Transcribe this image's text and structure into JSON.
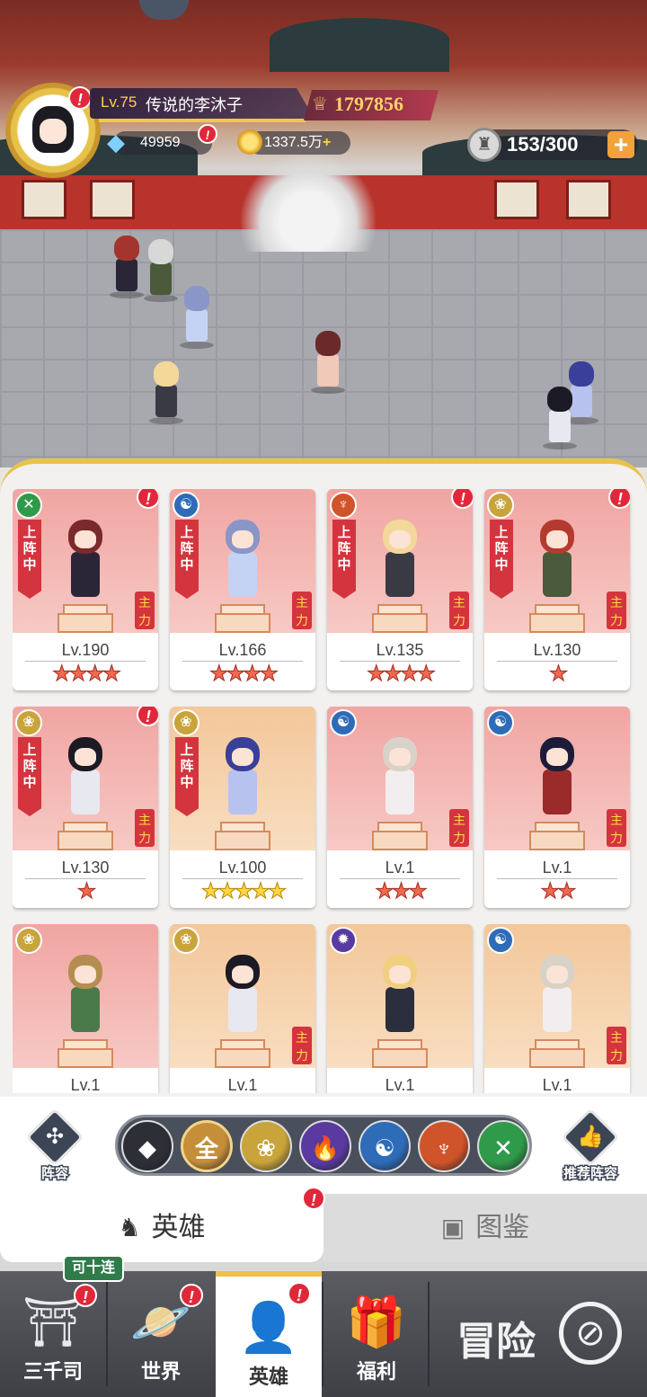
{
  "player": {
    "level": "Lv.75",
    "name": "传说的李沐子",
    "power": "1797856",
    "gems": "49959",
    "gold": "1337.5万",
    "capacity": "153/300"
  },
  "heroes": [
    {
      "level": "Lv.190",
      "stars": 4,
      "element": "dna",
      "deployed": true,
      "alert": true,
      "tag": true,
      "theme": "red",
      "hair": "#7a2a2a",
      "body": "#2b2538"
    },
    {
      "level": "Lv.166",
      "stars": 4,
      "element": "yin-yang",
      "deployed": true,
      "alert": false,
      "tag": true,
      "theme": "red",
      "hair": "#8a95c8",
      "body": "#c4d3f3"
    },
    {
      "level": "Lv.135",
      "stars": 4,
      "element": "meditation",
      "deployed": true,
      "alert": true,
      "tag": true,
      "theme": "red",
      "hair": "#f3d89a",
      "body": "#3a3a44"
    },
    {
      "level": "Lv.130",
      "stars": 1,
      "element": "lotus",
      "deployed": true,
      "alert": true,
      "tag": true,
      "theme": "red",
      "hair": "#b43a2f",
      "body": "#4a5a3a"
    },
    {
      "level": "Lv.130",
      "stars": 1,
      "element": "lotus",
      "deployed": true,
      "alert": true,
      "tag": true,
      "theme": "red",
      "hair": "#1c1a24",
      "body": "#e8e8f0"
    },
    {
      "level": "Lv.100",
      "stars": 5,
      "element": "lotus",
      "deployed": true,
      "alert": false,
      "tag": false,
      "theme": "gold",
      "hair": "#3a3f9a",
      "body": "#b8c2ee"
    },
    {
      "level": "Lv.1",
      "stars": 3,
      "element": "yin-yang",
      "deployed": false,
      "alert": false,
      "tag": true,
      "theme": "red",
      "hair": "#d8d2c8",
      "body": "#f2eef0"
    },
    {
      "level": "Lv.1",
      "stars": 2,
      "element": "yin-yang",
      "deployed": false,
      "alert": false,
      "tag": true,
      "theme": "red",
      "hair": "#1c1c3a",
      "body": "#9b2a2a"
    },
    {
      "level": "Lv.1",
      "stars": 0,
      "element": "lotus",
      "deployed": false,
      "alert": false,
      "tag": false,
      "theme": "red",
      "hair": "#b58d52",
      "body": "#4a7a4a"
    },
    {
      "level": "Lv.1",
      "stars": 0,
      "element": "lotus",
      "deployed": false,
      "alert": false,
      "tag": true,
      "theme": "gold",
      "hair": "#1c1a24",
      "body": "#e8e8f0"
    },
    {
      "level": "Lv.1",
      "stars": 0,
      "element": "fire",
      "deployed": false,
      "alert": false,
      "tag": false,
      "theme": "gold",
      "hair": "#f0d080",
      "body": "#2b2e3c"
    },
    {
      "level": "Lv.1",
      "stars": 0,
      "element": "yin-yang",
      "deployed": false,
      "alert": false,
      "tag": true,
      "theme": "gold",
      "hair": "#d8d2c8",
      "body": "#f2eef0"
    }
  ],
  "labels": {
    "deployed": "上阵中",
    "tag": "主力",
    "lineup": "阵容",
    "recommend": "推荐阵容",
    "all": "全"
  },
  "tabs": {
    "heroes": "英雄",
    "gallery": "图鉴"
  },
  "nav": {
    "badge": "可十连",
    "items": [
      "三千司",
      "世界",
      "英雄",
      "福利"
    ],
    "adventure": "冒险"
  },
  "colors": {
    "alert": "#e0283a",
    "accent_gold": "#f0c04a",
    "tag_red": "#d4343e"
  },
  "filters": [
    {
      "name": "diamond",
      "color": "#2d2f36",
      "icon": "◆"
    },
    {
      "name": "all",
      "color": "#c58f3a",
      "icon": "全"
    },
    {
      "name": "lotus",
      "color": "#c9a43a",
      "icon": "❀"
    },
    {
      "name": "fire",
      "color": "#5a3aa0",
      "icon": "🔥"
    },
    {
      "name": "yin-yang",
      "color": "#2e6cb8",
      "icon": "☯"
    },
    {
      "name": "meditation",
      "color": "#d0542a",
      "icon": "♆"
    },
    {
      "name": "dna",
      "color": "#2f9a4a",
      "icon": "✕"
    }
  ]
}
